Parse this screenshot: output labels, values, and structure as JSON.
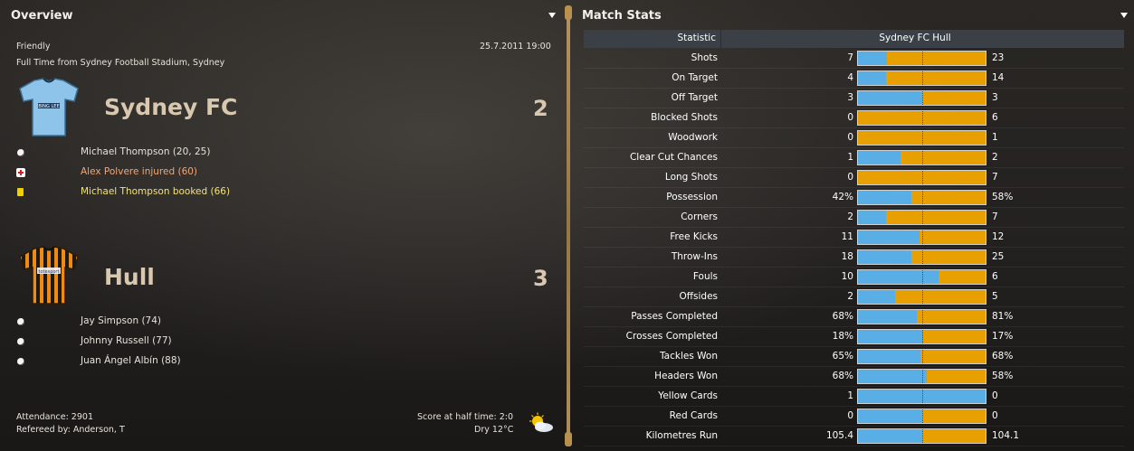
{
  "overview": {
    "title": "Overview",
    "competition": "Friendly",
    "datetime": "25.7.2011 19:00",
    "result_line": "Full Time from Sydney Football Stadium, Sydney",
    "home": {
      "name": "Sydney FC",
      "score": "2",
      "events": [
        {
          "icon": "goal-ball-icon",
          "text": "Michael Thompson (20, 25)",
          "color": "#ffffff"
        },
        {
          "icon": "injury-cross-icon",
          "text": "Alex Polvere injured (60)",
          "color": "#f0a878"
        },
        {
          "icon": "yellow-card-icon",
          "text": "Michael Thompson booked (66)",
          "color": "#f2e27a"
        }
      ]
    },
    "away": {
      "name": "Hull",
      "score": "3",
      "events": [
        {
          "icon": "goal-ball-icon",
          "text": "Jay Simpson (74)",
          "color": "#ffffff"
        },
        {
          "icon": "goal-ball-icon",
          "text": "Johnny Russell (77)",
          "color": "#ffffff"
        },
        {
          "icon": "goal-ball-icon",
          "text": "Juan Ángel Albín (88)",
          "color": "#ffffff"
        }
      ]
    },
    "attendance": "Attendance: 2901",
    "referee": "Refereed by: Anderson, T",
    "halftime": "Score at half time: 2:0",
    "weather": "Dry 12°C"
  },
  "match_stats": {
    "title": "Match Stats",
    "col_statistic": "Statistic",
    "col_teams": "Sydney FC Hull",
    "colors": {
      "home": "#5aaee6",
      "away": "#e8a000"
    },
    "rows": [
      {
        "label": "Shots",
        "home": "7",
        "away": "23",
        "share": 0.23
      },
      {
        "label": "On Target",
        "home": "4",
        "away": "14",
        "share": 0.22
      },
      {
        "label": "Off Target",
        "home": "3",
        "away": "3",
        "share": 0.5
      },
      {
        "label": "Blocked Shots",
        "home": "0",
        "away": "6",
        "share": 0.0
      },
      {
        "label": "Woodwork",
        "home": "0",
        "away": "1",
        "share": 0.0
      },
      {
        "label": "Clear Cut Chances",
        "home": "1",
        "away": "2",
        "share": 0.33
      },
      {
        "label": "Long Shots",
        "home": "0",
        "away": "7",
        "share": 0.0
      },
      {
        "label": "Possession",
        "home": "42%",
        "away": "58%",
        "share": 0.42
      },
      {
        "label": "Corners",
        "home": "2",
        "away": "7",
        "share": 0.22
      },
      {
        "label": "Free Kicks",
        "home": "11",
        "away": "12",
        "share": 0.48
      },
      {
        "label": "Throw-Ins",
        "home": "18",
        "away": "25",
        "share": 0.42
      },
      {
        "label": "Fouls",
        "home": "10",
        "away": "6",
        "share": 0.63
      },
      {
        "label": "Offsides",
        "home": "2",
        "away": "5",
        "share": 0.29
      },
      {
        "label": "Passes Completed",
        "home": "68%",
        "away": "81%",
        "share": 0.46
      },
      {
        "label": "Crosses Completed",
        "home": "18%",
        "away": "17%",
        "share": 0.51
      },
      {
        "label": "Tackles Won",
        "home": "65%",
        "away": "68%",
        "share": 0.49
      },
      {
        "label": "Headers Won",
        "home": "68%",
        "away": "58%",
        "share": 0.54
      },
      {
        "label": "Yellow Cards",
        "home": "1",
        "away": "0",
        "share": 1.0
      },
      {
        "label": "Red Cards",
        "home": "0",
        "away": "0",
        "share": 0.5
      },
      {
        "label": "Kilometres Run",
        "home": "105.4",
        "away": "104.1",
        "share": 0.5
      }
    ]
  }
}
